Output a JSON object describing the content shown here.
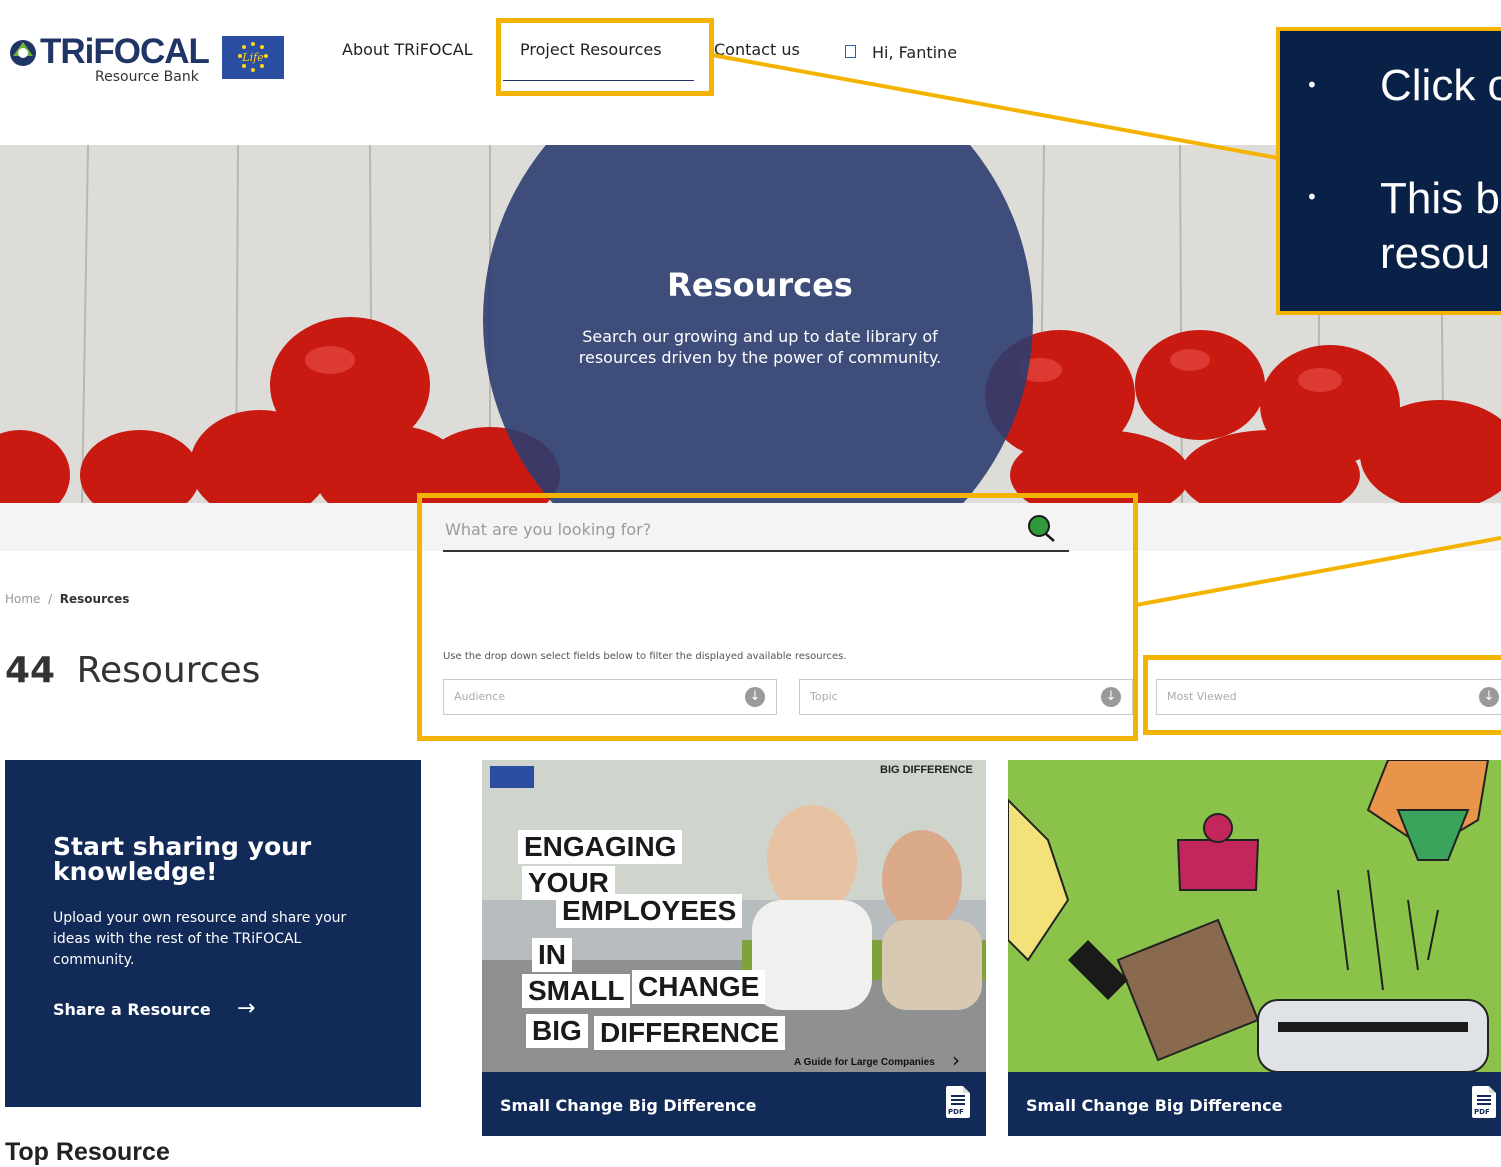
{
  "header": {
    "logo_text": "TRiFOCAL",
    "logo_subtitle": "Resource Bank",
    "nav": [
      "About TRiFOCAL",
      "Project Resources",
      "Contact us"
    ],
    "user_greeting": "Hi, Fantine"
  },
  "hero": {
    "title": "Resources",
    "description": "Search our growing and up to date library of resources driven by the power of community."
  },
  "search": {
    "placeholder": "What are you looking for?"
  },
  "breadcrumb": {
    "home": "Home",
    "separator": "/",
    "current": "Resources"
  },
  "results": {
    "count": "44",
    "label": "Resources"
  },
  "filters": {
    "hint": "Use the drop down select fields below to filter the displayed available resources.",
    "audience": "Audience",
    "topic": "Topic",
    "sort": "Most Viewed"
  },
  "share_card": {
    "title": "Start sharing your knowledge!",
    "text": "Upload your own resource and share your ideas with the rest of the TRiFOCAL community.",
    "link": "Share a Resource"
  },
  "top_resource_heading": "Top Resource",
  "resource_cards": [
    {
      "title": "Small Change Big Difference",
      "file_type": "PDF",
      "image_words": [
        "ENGAGING",
        "YOUR",
        "EMPLOYEES",
        "IN",
        "SMALL",
        "CHANGE",
        "BIG",
        "DIFFERENCE"
      ],
      "image_caption": "A Guide for Large Companies",
      "image_badge": "BIG DIFFERENCE"
    },
    {
      "title": "Small Change Big Difference",
      "file_type": "PDF"
    }
  ],
  "annotation": {
    "bullets": [
      "Click o",
      "This b",
      "resou"
    ]
  },
  "colors": {
    "navy": "#122a58",
    "highlight": "#f5b301",
    "hero_overlay": "#2c3d70"
  }
}
